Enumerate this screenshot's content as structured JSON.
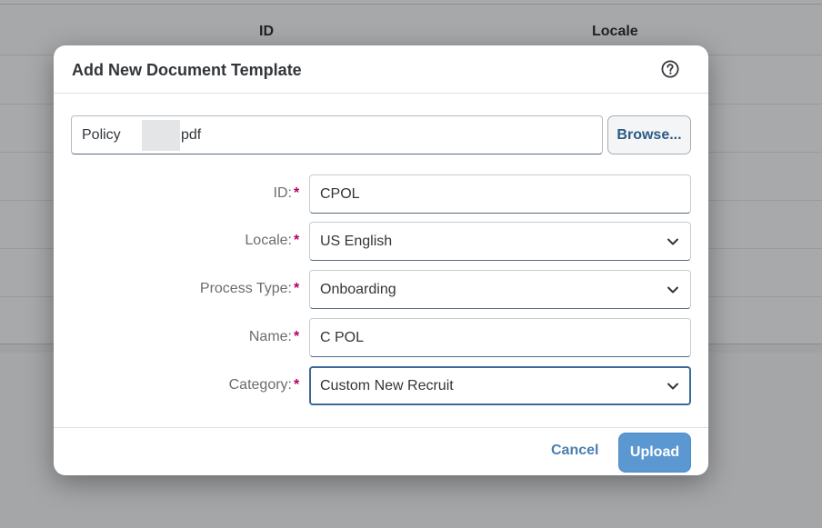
{
  "background_table": {
    "columns": [
      "ID",
      "Locale"
    ]
  },
  "dialog": {
    "title": "Add New Document Template",
    "help_icon": "help-circle-icon",
    "file": {
      "name_prefix": "Policy",
      "name_suffix": "pdf",
      "browse_label": "Browse..."
    },
    "fields": {
      "id": {
        "label": "ID:",
        "value": "CPOL"
      },
      "locale": {
        "label": "Locale:",
        "value": "US English"
      },
      "process_type": {
        "label": "Process Type:",
        "value": "Onboarding"
      },
      "name": {
        "label": "Name:",
        "value": "C POL"
      },
      "category": {
        "label": "Category:",
        "value": "Custom New Recruit"
      }
    },
    "required_marker": "*",
    "footer": {
      "cancel_label": "Cancel",
      "upload_label": "Upload"
    }
  },
  "colors": {
    "accent": "#5b98d2",
    "link": "#4a7eb0",
    "required": "#b3006b"
  }
}
